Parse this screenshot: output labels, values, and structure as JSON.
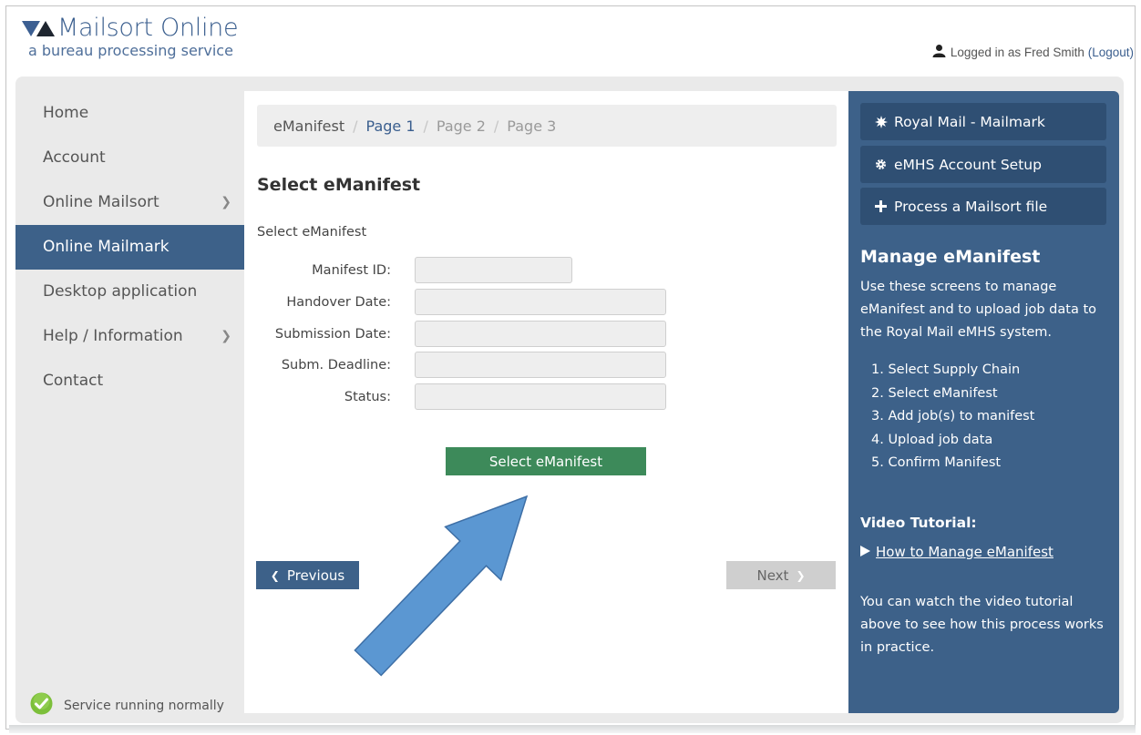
{
  "header": {
    "logo_title": "Mailsort Online",
    "logo_subtitle": "a bureau processing service",
    "login_prefix": "Logged in as Fred Smith",
    "logout_label": "(Logout)"
  },
  "sidebar": {
    "items": [
      {
        "label": "Home",
        "active": false
      },
      {
        "label": "Account",
        "active": false
      },
      {
        "label": "Online Mailsort",
        "active": false
      },
      {
        "label": "Online Mailmark",
        "active": true
      },
      {
        "label": "Desktop application",
        "active": false
      },
      {
        "label": "Help / Information",
        "active": false
      },
      {
        "label": "Contact",
        "active": false
      }
    ],
    "status_text": "Service running normally"
  },
  "breadcrumb": {
    "items": [
      "eManifest",
      "Page 1",
      "Page 2",
      "Page 3"
    ],
    "separator": "/"
  },
  "main": {
    "title": "Select eManifest",
    "sub_label": "Select eManifest",
    "fields": [
      {
        "label": "Manifest ID:",
        "value": ""
      },
      {
        "label": "Handover Date:",
        "value": ""
      },
      {
        "label": "Submission Date:",
        "value": ""
      },
      {
        "label": "Subm. Deadline:",
        "value": ""
      },
      {
        "label": "Status:",
        "value": ""
      }
    ],
    "select_button": "Select eManifest",
    "previous_button": "Previous",
    "next_button": "Next"
  },
  "right_panel": {
    "buttons": [
      {
        "icon": "starburst-icon",
        "label": "Royal Mail - Mailmark"
      },
      {
        "icon": "gear-icon",
        "label": "eMHS Account Setup"
      },
      {
        "icon": "plus-icon",
        "label": "Process a Mailsort file"
      }
    ],
    "title": "Manage eManifest",
    "description": "Use these screens to manage eManifest and to upload job data to the Royal Mail eMHS system.",
    "steps": [
      "1. Select Supply Chain",
      "2. Select eManifest",
      "3. Add job(s) to manifest",
      "4. Upload job data",
      "5. Confirm Manifest"
    ],
    "video_title": "Video Tutorial:",
    "video_link": "How to Manage eManifest",
    "video_note": "You can watch the video tutorial above to see how this process works in practice."
  },
  "colors": {
    "brand": "#3a5e8e",
    "nav_active": "#3d6189",
    "primary_button": "#3d8a5a",
    "panel": "#3d6189"
  }
}
